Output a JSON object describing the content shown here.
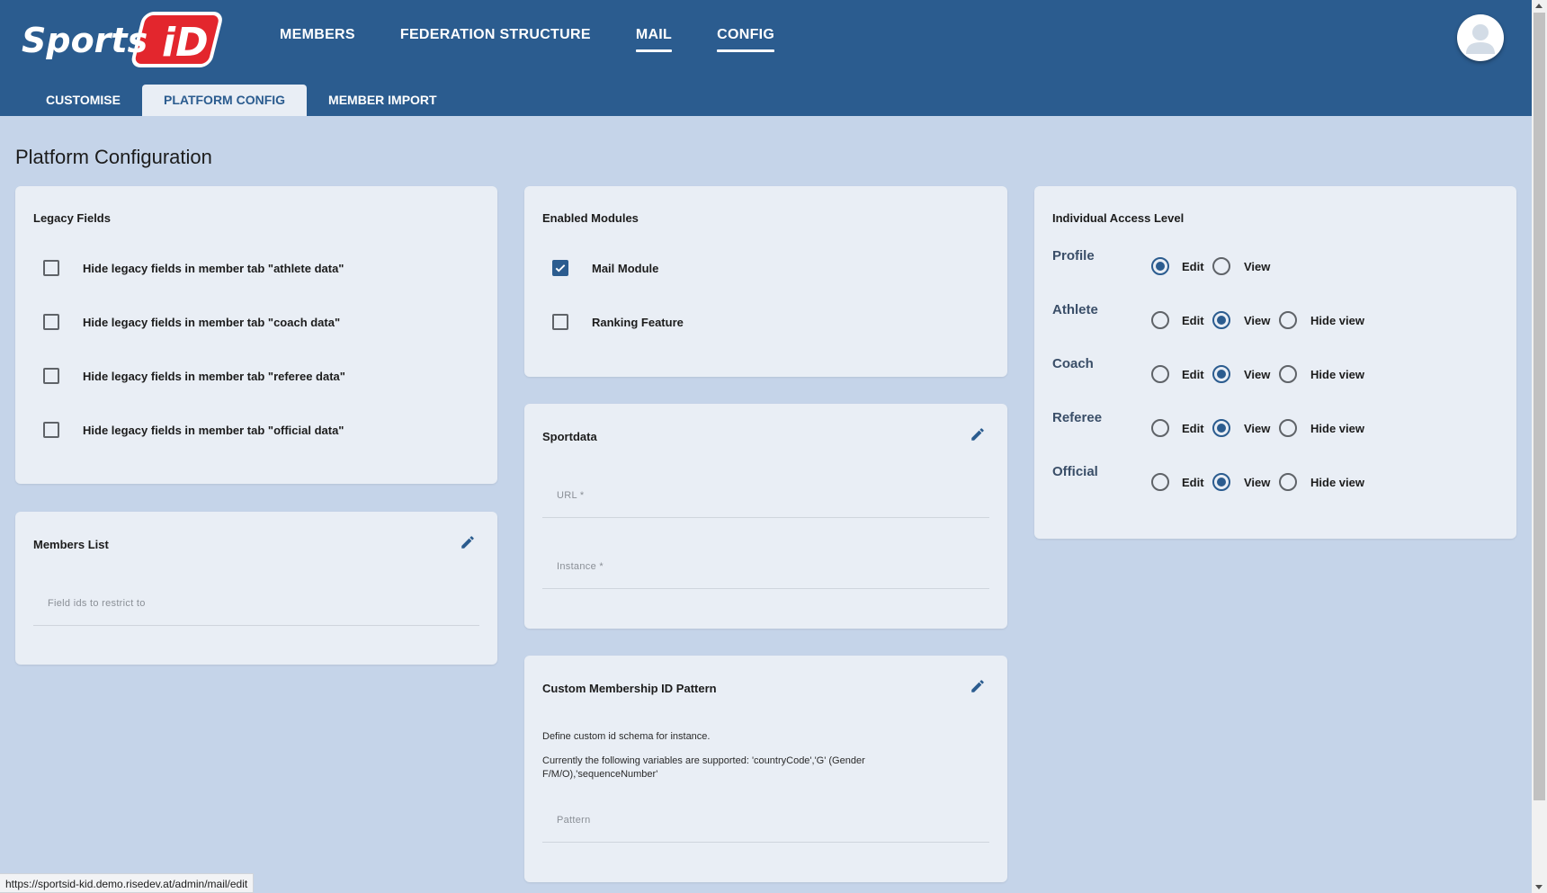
{
  "brand": {
    "logo_text_1": "Sports",
    "logo_text_2": "iD"
  },
  "main_nav": [
    {
      "label": "MEMBERS",
      "active": false
    },
    {
      "label": "FEDERATION STRUCTURE",
      "active": false
    },
    {
      "label": "MAIL",
      "active": true
    },
    {
      "label": "CONFIG",
      "active": true
    }
  ],
  "sub_nav": [
    {
      "label": "CUSTOMISE",
      "active": false
    },
    {
      "label": "PLATFORM CONFIG",
      "active": true
    },
    {
      "label": "MEMBER IMPORT",
      "active": false
    }
  ],
  "page_title": "Platform Configuration",
  "legacy_fields": {
    "title": "Legacy Fields",
    "options": [
      {
        "label": "Hide legacy fields in member tab \"athlete data\"",
        "checked": false
      },
      {
        "label": "Hide legacy fields in member tab \"coach data\"",
        "checked": false
      },
      {
        "label": "Hide legacy fields in member tab \"referee data\"",
        "checked": false
      },
      {
        "label": "Hide legacy fields in member tab \"official data\"",
        "checked": false
      }
    ]
  },
  "members_list": {
    "title": "Members List",
    "field_placeholder": "Field ids to restrict to"
  },
  "enabled_modules": {
    "title": "Enabled Modules",
    "options": [
      {
        "label": "Mail Module",
        "checked": true
      },
      {
        "label": "Ranking Feature",
        "checked": false
      }
    ]
  },
  "sportdata": {
    "title": "Sportdata",
    "url_placeholder": "URL *",
    "instance_placeholder": "Instance *"
  },
  "custom_id": {
    "title": "Custom Membership ID Pattern",
    "desc_1": "Define custom id schema for instance.",
    "desc_2": "Currently the following variables are supported: 'countryCode','G' (Gender F/M/O),'sequenceNumber'",
    "pattern_placeholder": "Pattern"
  },
  "access_level": {
    "title": "Individual Access Level",
    "option_labels": {
      "edit": "Edit",
      "view": "View",
      "hide": "Hide view"
    },
    "rows": [
      {
        "label": "Profile",
        "selected": "edit",
        "has_hide": false
      },
      {
        "label": "Athlete",
        "selected": "view",
        "has_hide": true
      },
      {
        "label": "Coach",
        "selected": "view",
        "has_hide": true
      },
      {
        "label": "Referee",
        "selected": "view",
        "has_hide": true
      },
      {
        "label": "Official",
        "selected": "view",
        "has_hide": true
      }
    ]
  },
  "status_bar": {
    "url": "https://sportsid-kid.demo.risedev.at/admin/mail/edit"
  },
  "colors": {
    "header": "#2b5c8f",
    "background": "#c5d4e9",
    "card": "#e9eef5",
    "accent": "#2b5c8f",
    "logo_red": "#e3262d"
  }
}
